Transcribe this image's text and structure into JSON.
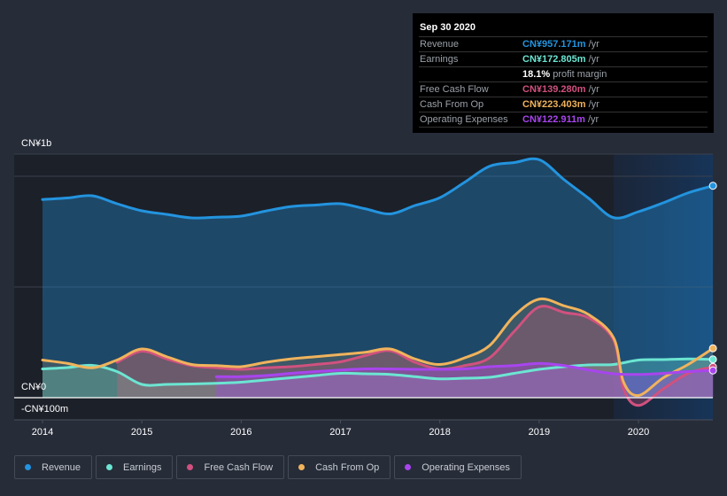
{
  "tooltip": {
    "date": "Sep 30 2020",
    "rows": [
      {
        "label": "Revenue",
        "value": "CN¥957.171m",
        "unit": "/yr",
        "color": "#2394df"
      },
      {
        "label": "Earnings",
        "value": "CN¥172.805m",
        "unit": "/yr",
        "color": "#6ce5d2"
      },
      {
        "label": "",
        "value": "18.1%",
        "unit": "profit margin",
        "color": "#ffffff"
      },
      {
        "label": "Free Cash Flow",
        "value": "CN¥139.280m",
        "unit": "/yr",
        "color": "#d1517f"
      },
      {
        "label": "Cash From Op",
        "value": "CN¥223.403m",
        "unit": "/yr",
        "color": "#f0b35c"
      },
      {
        "label": "Operating Expenses",
        "value": "CN¥122.911m",
        "unit": "/yr",
        "color": "#a845ee"
      }
    ]
  },
  "legend": [
    {
      "label": "Revenue",
      "color": "#2394df"
    },
    {
      "label": "Earnings",
      "color": "#6ce5d2"
    },
    {
      "label": "Free Cash Flow",
      "color": "#d1517f"
    },
    {
      "label": "Cash From Op",
      "color": "#f0b35c"
    },
    {
      "label": "Operating Expenses",
      "color": "#a845ee"
    }
  ],
  "chart_data": {
    "type": "area",
    "title": "",
    "xlabel": "",
    "ylabel": "",
    "y_unit": "CN¥ millions",
    "ylim": [
      -100,
      1100
    ],
    "xlim": [
      2014.0,
      2020.75
    ],
    "y_tick_labels": [
      {
        "value": 1000,
        "label": "CN¥1b"
      },
      {
        "value": 0,
        "label": "CN¥0"
      },
      {
        "value": -100,
        "label": "-CN¥100m"
      }
    ],
    "x_tick_labels": [
      "2014",
      "2015",
      "2016",
      "2017",
      "2018",
      "2019",
      "2020"
    ],
    "x_ticks": [
      2014,
      2015,
      2016,
      2017,
      2018,
      2019,
      2020
    ],
    "grid": true,
    "highlight_start": 2019.75,
    "series": [
      {
        "name": "Revenue",
        "color": "#2394df",
        "x": [
          2014.0,
          2014.25,
          2014.5,
          2014.75,
          2015.0,
          2015.25,
          2015.5,
          2015.75,
          2016.0,
          2016.25,
          2016.5,
          2016.75,
          2017.0,
          2017.25,
          2017.5,
          2017.75,
          2018.0,
          2018.25,
          2018.5,
          2018.75,
          2019.0,
          2019.25,
          2019.5,
          2019.75,
          2020.0,
          2020.25,
          2020.5,
          2020.75
        ],
        "values": [
          895,
          902,
          912,
          876,
          844,
          828,
          812,
          815,
          820,
          843,
          863,
          870,
          876,
          853,
          830,
          868,
          903,
          973,
          1045,
          1062,
          1075,
          985,
          900,
          813,
          840,
          880,
          925,
          957
        ]
      },
      {
        "name": "Earnings",
        "color": "#6ce5d2",
        "x": [
          2014.0,
          2014.25,
          2014.5,
          2014.75,
          2015.0,
          2015.25,
          2015.5,
          2015.75,
          2016.0,
          2016.25,
          2016.5,
          2016.75,
          2017.0,
          2017.25,
          2017.5,
          2017.75,
          2018.0,
          2018.25,
          2018.5,
          2018.75,
          2019.0,
          2019.25,
          2019.5,
          2019.75,
          2020.0,
          2020.25,
          2020.5,
          2020.75
        ],
        "values": [
          130,
          136,
          146,
          118,
          60,
          60,
          62,
          65,
          70,
          80,
          90,
          100,
          110,
          108,
          105,
          95,
          85,
          88,
          92,
          110,
          128,
          140,
          148,
          150,
          170,
          172,
          175,
          173
        ]
      },
      {
        "name": "Free Cash Flow",
        "color": "#d1517f",
        "x": [
          2014.75,
          2015.0,
          2015.25,
          2015.5,
          2015.75,
          2016.0,
          2016.25,
          2016.5,
          2016.75,
          2017.0,
          2017.25,
          2017.5,
          2017.75,
          2018.0,
          2018.25,
          2018.5,
          2018.75,
          2019.0,
          2019.25,
          2019.5,
          2019.75,
          2019.85,
          2020.0,
          2020.25,
          2020.5,
          2020.75
        ],
        "values": [
          160,
          210,
          175,
          145,
          135,
          128,
          135,
          140,
          150,
          162,
          190,
          212,
          160,
          130,
          145,
          180,
          300,
          410,
          385,
          360,
          260,
          40,
          -35,
          40,
          110,
          139
        ]
      },
      {
        "name": "Cash From Op",
        "color": "#f0b35c",
        "x": [
          2014.0,
          2014.25,
          2014.5,
          2014.75,
          2015.0,
          2015.25,
          2015.5,
          2015.75,
          2016.0,
          2016.25,
          2016.5,
          2016.75,
          2017.0,
          2017.25,
          2017.5,
          2017.75,
          2018.0,
          2018.25,
          2018.5,
          2018.75,
          2019.0,
          2019.25,
          2019.5,
          2019.75,
          2019.85,
          2020.0,
          2020.25,
          2020.5,
          2020.75
        ],
        "values": [
          170,
          155,
          135,
          170,
          220,
          185,
          150,
          145,
          140,
          160,
          175,
          185,
          195,
          205,
          220,
          175,
          150,
          180,
          235,
          370,
          445,
          415,
          375,
          270,
          70,
          10,
          90,
          150,
          223
        ]
      },
      {
        "name": "Operating Expenses",
        "color": "#a845ee",
        "x": [
          2015.75,
          2016.0,
          2016.25,
          2016.5,
          2016.75,
          2017.0,
          2017.25,
          2017.5,
          2017.75,
          2018.0,
          2018.25,
          2018.5,
          2018.75,
          2019.0,
          2019.25,
          2019.5,
          2019.75,
          2020.0,
          2020.25,
          2020.5,
          2020.75
        ],
        "values": [
          95,
          95,
          100,
          110,
          118,
          125,
          130,
          130,
          128,
          128,
          130,
          140,
          145,
          155,
          145,
          125,
          108,
          105,
          110,
          118,
          123
        ]
      }
    ]
  }
}
